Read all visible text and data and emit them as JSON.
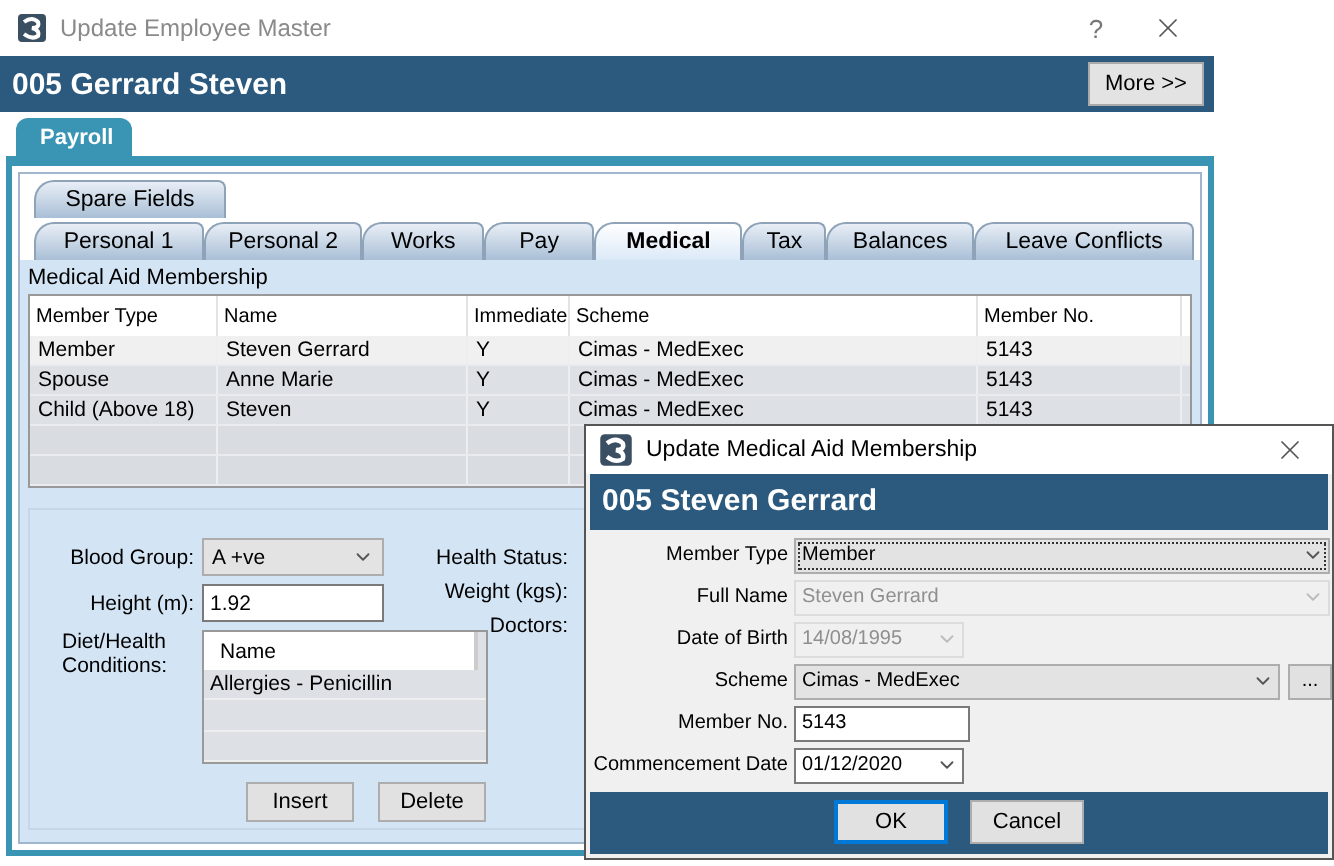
{
  "window": {
    "title": "Update Employee Master",
    "help_button": "?"
  },
  "header": {
    "title": "005 Gerrard Steven",
    "more_button": "More >>"
  },
  "module_tabs": [
    {
      "label": "Payroll",
      "selected": true
    }
  ],
  "tab_rows": [
    {
      "tabs": [
        {
          "label": "Spare Fields",
          "selected": false
        }
      ]
    },
    {
      "tabs": [
        {
          "label": "Personal 1",
          "selected": false
        },
        {
          "label": "Personal 2",
          "selected": false
        },
        {
          "label": "Works",
          "selected": false
        },
        {
          "label": "Pay",
          "selected": false
        },
        {
          "label": "Medical",
          "selected": true
        },
        {
          "label": "Tax",
          "selected": false
        },
        {
          "label": "Balances",
          "selected": false
        },
        {
          "label": "Leave Conflicts",
          "selected": false
        }
      ]
    }
  ],
  "membership": {
    "title": "Medical Aid Membership",
    "columns": [
      "Member Type",
      "Name",
      "Immediate",
      "Scheme",
      "Member No."
    ],
    "rows": [
      {
        "cells": [
          "Member",
          "Steven Gerrard",
          "Y",
          "Cimas - MedExec",
          "5143"
        ],
        "selected": true
      },
      {
        "cells": [
          "Spouse",
          "Anne Marie",
          "Y",
          "Cimas - MedExec",
          "5143"
        ],
        "selected": false
      },
      {
        "cells": [
          "Child (Above 18)",
          "Steven",
          "Y",
          "Cimas - MedExec",
          "5143"
        ],
        "selected": false
      }
    ]
  },
  "health": {
    "blood_group": {
      "label": "Blood Group:",
      "value": "A +ve"
    },
    "height": {
      "label": "Height (m):",
      "value": "1.92"
    },
    "conditions": {
      "label": "Diet/Health Conditions:",
      "column": "Name",
      "rows": [
        "Allergies - Penicillin"
      ]
    },
    "buttons": [
      "Insert",
      "Delete"
    ],
    "right_labels": [
      "Health Status:",
      "Weight (kgs):",
      "Doctors:"
    ]
  },
  "dialog": {
    "title": "Update Medical Aid Membership",
    "header": "005 Steven Gerrard",
    "fields": [
      {
        "label": "Member Type",
        "value": "Member",
        "kind": "select",
        "disabled": false,
        "focused": true
      },
      {
        "label": "Full Name",
        "value": "Steven Gerrard",
        "kind": "select",
        "disabled": true,
        "focused": false
      },
      {
        "label": "Date of Birth",
        "value": "14/08/1995",
        "kind": "date",
        "disabled": true,
        "focused": false
      },
      {
        "label": "Scheme",
        "value": "Cimas - MedExec",
        "kind": "browse",
        "browse_button": "...",
        "disabled": false,
        "focused": false
      },
      {
        "label": "Member No.",
        "value": "5143",
        "kind": "text",
        "disabled": false,
        "focused": false
      },
      {
        "label": "Commencement Date",
        "value": "01/12/2020",
        "kind": "date",
        "disabled": false,
        "focused": false
      }
    ],
    "buttons": [
      {
        "label": "OK",
        "default": true
      },
      {
        "label": "Cancel",
        "default": false
      }
    ]
  }
}
